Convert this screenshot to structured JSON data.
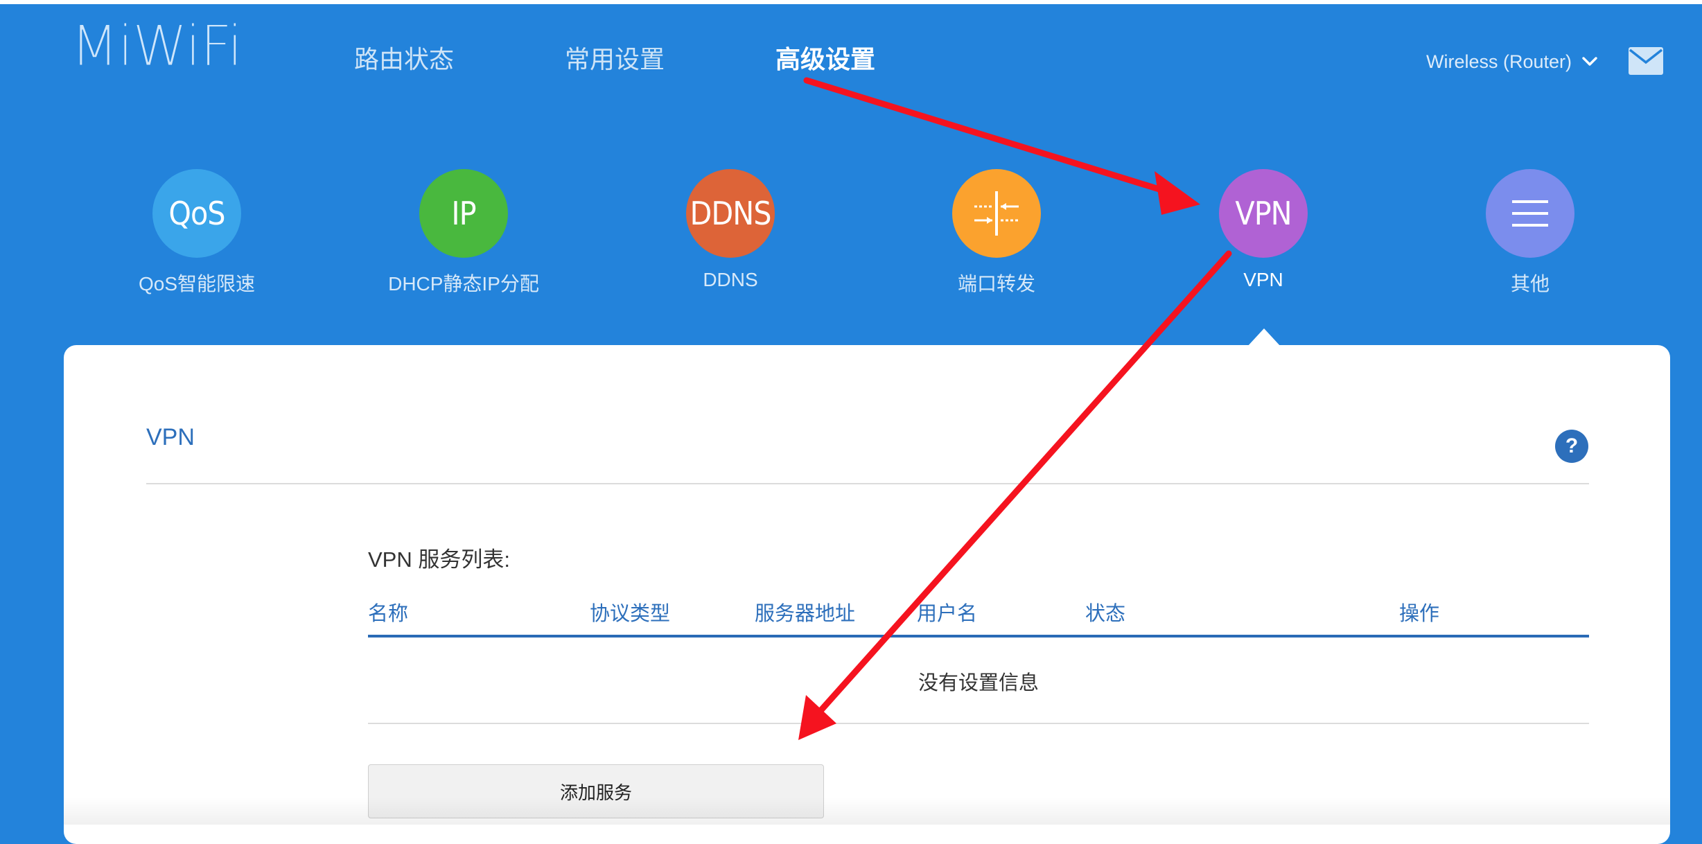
{
  "header": {
    "logo": "MiWiFi",
    "nav": [
      "路由状态",
      "常用设置",
      "高级设置"
    ],
    "active_nav": "高级设置",
    "device_label": "Wireless (Router)"
  },
  "features": [
    {
      "icon_text": "QoS",
      "label": "QoS智能限速",
      "color": "#3aa5ea",
      "icon": "qos-icon"
    },
    {
      "icon_text": "IP",
      "label": "DHCP静态IP分配",
      "color": "#49b83e",
      "icon": "ip-icon"
    },
    {
      "icon_text": "DDNS",
      "label": "DDNS",
      "color": "#dd6438",
      "icon": "ddns-icon"
    },
    {
      "icon_text": "",
      "label": "端口转发",
      "color": "#fba22e",
      "icon": "port-forward-icon"
    },
    {
      "icon_text": "VPN",
      "label": "VPN",
      "color": "#b062d4",
      "icon": "vpn-icon"
    },
    {
      "icon_text": "",
      "label": "其他",
      "color": "#7b8ded",
      "icon": "menu-icon"
    }
  ],
  "active_feature": "VPN",
  "panel": {
    "title": "VPN",
    "help_symbol": "?",
    "list_title": "VPN 服务列表:",
    "columns": [
      "名称",
      "协议类型",
      "服务器地址",
      "用户名",
      "状态",
      "操作"
    ],
    "empty_text": "没有设置信息",
    "add_button": "添加服务"
  },
  "colors": {
    "background": "#2383db",
    "accent_text": "#2d6fbb",
    "annotation_arrow": "#f5131f"
  }
}
